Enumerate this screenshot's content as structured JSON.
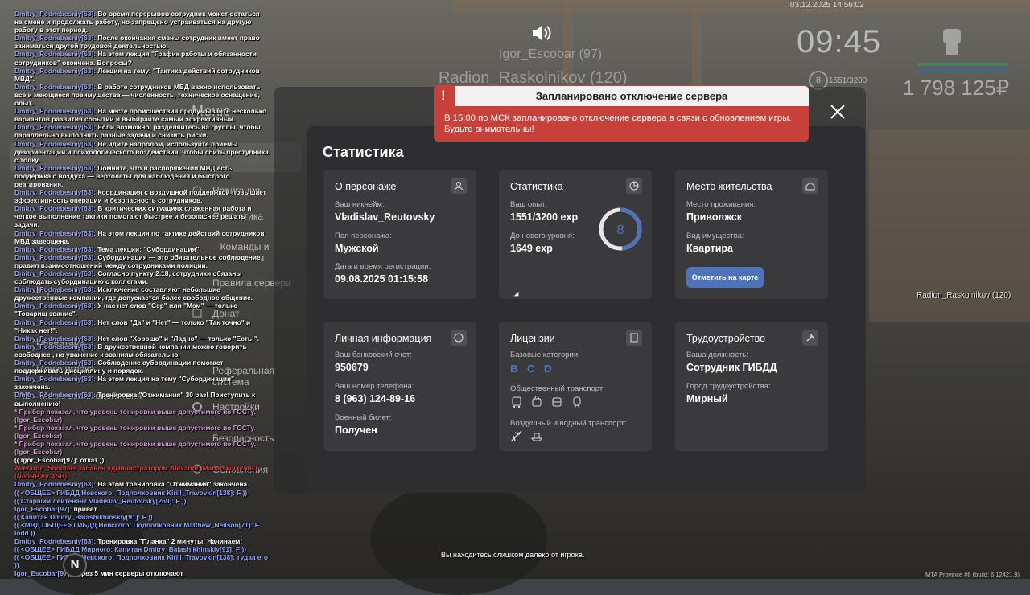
{
  "hud": {
    "datetime": "03.12.2025 14:56:02",
    "clock": "09:45",
    "level": "8",
    "exp": "1551/3200",
    "money": "1 798 125₽",
    "nametag_1": "Igor_Escobar (97)",
    "nametag_2": "Radion_Raskolnikov (120)"
  },
  "chat": [
    {
      "nick": "Dmitry_Podnebesniy[63]:",
      "text": " Во время перерывов сотрудник может остаться на смене и продолжать работу, но запрещено устраиваться на другую работу в этот период.",
      "cls": ""
    },
    {
      "nick": "Dmitry_Podnebesniy[63]:",
      "text": " После окончания смены сотрудник имеет право заниматься другой трудовой деятельностью.",
      "cls": ""
    },
    {
      "nick": "Dmitry_Podnebesniy[63]:",
      "text": " На этом лекция \"График работы и обязанности сотрудников\" окончена. Вопросы?",
      "cls": ""
    },
    {
      "nick": "Dmitry_Podnebesniy[63]:",
      "text": " Лекция на тему: \"Тактика действий сотрудников МВД\".",
      "cls": ""
    },
    {
      "nick": "Dmitry_Podnebesniy[63]:",
      "text": " В работе сотрудников МВД важно использовать все и меющиеся преимущества — численность, техническое оснащение, опыт.",
      "cls": ""
    },
    {
      "nick": "Dmitry_Podnebesniy[63]:",
      "text": " На месте происшествия продумывайте несколько вариантов развития событий и выбирайте самый эффективный.",
      "cls": ""
    },
    {
      "nick": "Dmitry_Podnebesniy[63]:",
      "text": " Если возможно, разделяйтесь на группы, чтобы параллельно выполнять разные задачи и снизить риски.",
      "cls": ""
    },
    {
      "nick": "Dmitry_Podnebesniy[63]:",
      "text": " Не идите напролом, используйте приёмы дезориентации и психологического воздействия, чтобы сбить преступника с толку.",
      "cls": ""
    },
    {
      "nick": "Dmitry_Podnebesniy[63]:",
      "text": " Помните, что в распоряжении МВД есть поддержка с воздуха — вертолеты для наблюдения и быстрого реагирования.",
      "cls": ""
    },
    {
      "nick": "Dmitry_Podnebesniy[63]:",
      "text": " Координация с воздушной поддержкой повышает эффективность операции и безопасность сотрудников.",
      "cls": ""
    },
    {
      "nick": "Dmitry_Podnebesniy[63]:",
      "text": " В критических ситуациях слаженная работа и четкое выполнение тактики помогают быстрее и безопаснее решать задачи.",
      "cls": ""
    },
    {
      "nick": "Dmitry_Podnebesniy[63]:",
      "text": " На этом лекция по тактике действий сотрудников МВД завершена.",
      "cls": ""
    },
    {
      "nick": "Dmitry_Podnebesniy[63]:",
      "text": " Тема лекции: \"Субординация\".",
      "cls": ""
    },
    {
      "nick": "Dmitry_Podnebesniy[63]:",
      "text": " Субординация — это обязательное соблюдение правил взаимоотношений между сотрудниками полиции.",
      "cls": ""
    },
    {
      "nick": "Dmitry_Podnebesniy[63]:",
      "text": " Согласно пункту 2.18, сотрудники обязаны соблюдать субординацию с коллегами.",
      "cls": ""
    },
    {
      "nick": "Dmitry_Podnebesniy[63]:",
      "text": " Исключение составляют небольшие дружественные компании, где допускается более свободное общение.",
      "cls": ""
    },
    {
      "nick": "Dmitry_Podnebesniy[63]:",
      "text": " У нас нет слов \"Сэр\" или \"Мэм\" — только \"Товарищ звание\".",
      "cls": ""
    },
    {
      "nick": "Dmitry_Podnebesniy[63]:",
      "text": " Нет слов \"Да\" и \"Нет\" — только \"Так точно\" и \"Никак нет!\".",
      "cls": ""
    },
    {
      "nick": "Dmitry_Podnebesniy[63]:",
      "text": " Нет слов \"Хорошо\" и \"Ладно\" — только \"Есть!\".",
      "cls": ""
    },
    {
      "nick": "Dmitry_Podnebesniy[63]:",
      "text": " В дружественной компании можно говорить свободнее , но уважение к званиям обязательно.",
      "cls": ""
    },
    {
      "nick": "Dmitry_Podnebesniy[63]:",
      "text": " Соблюдение субординации помогает поддерживать дисциплину и порядок.",
      "cls": ""
    },
    {
      "nick": "Dmitry_Podnebesniy[63]:",
      "text": " На этом лекция на тему \"Субординация\" закончена.",
      "cls": ""
    },
    {
      "nick": "Dmitry_Podnebesniy[63]:",
      "text": " Тренировка \"Отжимания\" 30 раз! Приступить к выполнению!",
      "cls": ""
    },
    {
      "nick": "",
      "text": " * Прибор показал, что уровень тонировки выше допустимого по ГОСТу. (Igor_Escobar)",
      "cls": "pink"
    },
    {
      "nick": "",
      "text": " * Прибор показал, что уровень тонировки выше допустимого по ГОСТу. (Igor_Escobar)",
      "cls": "pink"
    },
    {
      "nick": "",
      "text": " * Прибор показал, что уровень тонировки выше допустимого по ГОСТу. (Igor_Escobar)",
      "cls": "pink"
    },
    {
      "nick": "",
      "text": "(( Igor_Escobar[97]: откат ))",
      "cls": ""
    },
    {
      "nick": "",
      "text": "Averardo_Shooters забанен администратором Alexandr_Manarskiy (2 дн.) (NonRP by ASB)",
      "cls": "red"
    },
    {
      "nick": "Dmitry_Podnebesniy[63]:",
      "text": " На этом тренировка \"Отжимания\" закончена.",
      "cls": ""
    },
    {
      "nick": "",
      "text": "(( <ОБЩЕЕ> ГИБДД Невского: Подполковник Kirill_Travovkin[138]: F ))",
      "cls": "blue"
    },
    {
      "nick": "",
      "text": "(( Старший лейтенант Vladislav_Reutovsky[269]: F ))",
      "cls": "blue"
    },
    {
      "nick": "Igor_Escobar[97]:",
      "text": " привет",
      "cls": ""
    },
    {
      "nick": "",
      "text": "(( Капитан Dmitry_Balashikhinskiy[91]: F ))",
      "cls": "blue"
    },
    {
      "nick": "",
      "text": "(( <МВД.ОБЩЕЕ> ГИБДД Невского: Подполковник Matthew_Neilson[71]: F Iodd ))",
      "cls": "blue"
    },
    {
      "nick": "Dmitry_Podnebesniy[63]:",
      "text": " Тренировка \"Планка\" 2 минуты! Начинаем!",
      "cls": ""
    },
    {
      "nick": "",
      "text": "(( <ОБЩЕЕ> ГИБДД Мирного: Капитан Dmitry_Balashikhinskiy[91]: F ))",
      "cls": "blue"
    },
    {
      "nick": "",
      "text": "(( <ОБЩЕЕ> ГИБДД Невского: Подполковник Kirill_Travovkin[138]: тудаа его ))",
      "cls": "blue"
    },
    {
      "nick": "Igor_Escobar[97]:",
      "text": " через 5 мин серверы отключают",
      "cls": ""
    }
  ],
  "menu": {
    "title": "Меню",
    "items": [
      "Навигация",
      "Статистика",
      "Команды и клавиши",
      "Правила сервера",
      "Донат",
      "Реферальная система",
      "Настройки",
      "Безопасность",
      "Обновления"
    ],
    "left_items": [
      "Карта",
      "Инвентарь",
      "Меню игрока",
      "TAB - Меню взаимодействия"
    ]
  },
  "alert": {
    "title": "Запланировано отключение сервера",
    "bang": "!",
    "text": "В 15:00 по МСК запланировано отключение сервера в связи с обновлением игры. Будьте внимательны!"
  },
  "stats": {
    "heading": "Статистика",
    "persona": {
      "title": "О персонаже",
      "nick_label": "Ваш никнейм:",
      "nick": "Vladislav_Reutovsky",
      "gender_label": "Пол персонажа:",
      "gender": "Мужской",
      "reg_label": "Дата и время регистрации:",
      "reg": "09.08.2025 01:15:58"
    },
    "stat": {
      "title": "Статистика",
      "exp_label": "Ваш опыт:",
      "exp": "1551/3200 exp",
      "next_label": "До нового уровня:",
      "next": "1649 exp",
      "level": "8",
      "progress": 0.485
    },
    "residence": {
      "title": "Место жительства",
      "place_label": "Место проживания:",
      "place": "Приволжск",
      "type_label": "Вид имущества:",
      "type": "Квартира",
      "button": "Отметить на карте"
    },
    "personal": {
      "title": "Личная информация",
      "bank_label": "Ваш банковский счет:",
      "bank": "950679",
      "phone_label": "Ваш номер телефона:",
      "phone": "8 (963) 124-89-16",
      "mil_label": "Военный билет:",
      "mil": "Получен"
    },
    "licenses": {
      "title": "Лицензии",
      "base_label": "Базовые категории:",
      "base": "B C D",
      "public_label": "Общественный транспорт:",
      "air_label": "Воздушный и водный транспорт:"
    },
    "job": {
      "title": "Трудоустройство",
      "pos_label": "Ваша должность:",
      "pos": "Сотрудник ГИБДД",
      "city_label": "Город трудоустройства:",
      "city": "Мирный"
    }
  },
  "status_message": "Вы находитесь слишком далеко от игрока.",
  "right_tag": "Radion_Raskolnikov (120)",
  "build": "MTA Province #6 (build: 6.12421.9)",
  "compass": "N",
  "colors": {
    "accent": "#4e73b8",
    "alert": "#c8403a",
    "panel": "#2e2e30",
    "card": "#3a3a3c"
  }
}
